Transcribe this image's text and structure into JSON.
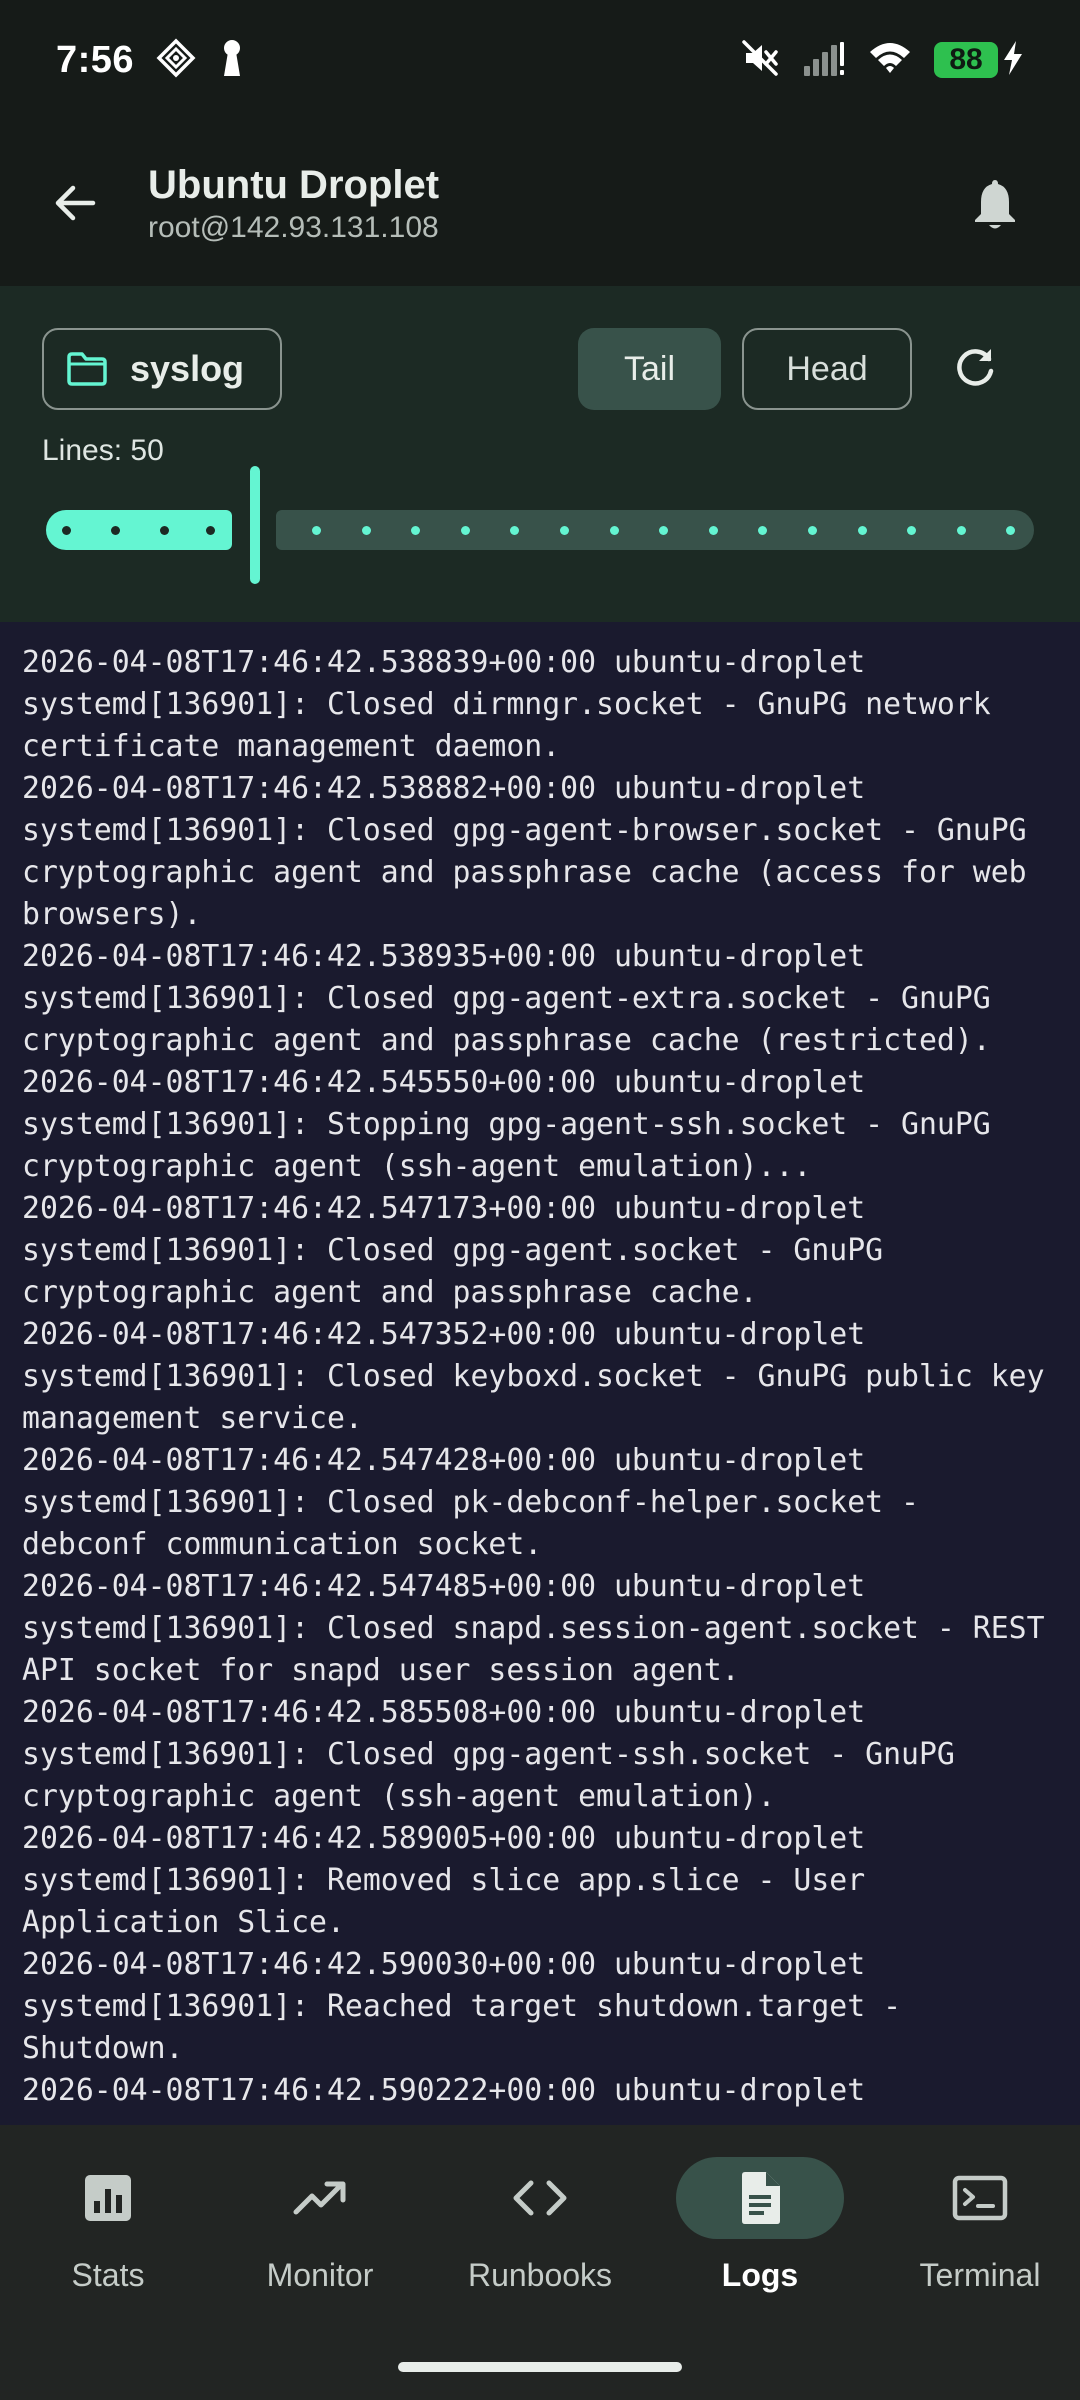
{
  "status_bar": {
    "time": "7:56",
    "battery": "88",
    "icons": [
      "location-diamond-icon",
      "keyhole-icon",
      "mute-icon",
      "signal-icon",
      "wifi-icon",
      "charging-bolt-icon"
    ]
  },
  "app_bar": {
    "title": "Ubuntu Droplet",
    "subtitle": "root@142.93.131.108"
  },
  "controls": {
    "file_label": "syslog",
    "tail_label": "Tail",
    "head_label": "Head",
    "lines_label": "Lines: 50",
    "lines_value": 50
  },
  "log": {
    "text": "2026-04-08T17:46:42.538839+00:00 ubuntu-droplet systemd[136901]: Closed dirmngr.socket - GnuPG network certificate management daemon.\n2026-04-08T17:46:42.538882+00:00 ubuntu-droplet systemd[136901]: Closed gpg-agent-browser.socket - GnuPG cryptographic agent and passphrase cache (access for web browsers).\n2026-04-08T17:46:42.538935+00:00 ubuntu-droplet systemd[136901]: Closed gpg-agent-extra.socket - GnuPG cryptographic agent and passphrase cache (restricted).\n2026-04-08T17:46:42.545550+00:00 ubuntu-droplet systemd[136901]: Stopping gpg-agent-ssh.socket - GnuPG cryptographic agent (ssh-agent emulation)...\n2026-04-08T17:46:42.547173+00:00 ubuntu-droplet systemd[136901]: Closed gpg-agent.socket - GnuPG cryptographic agent and passphrase cache.\n2026-04-08T17:46:42.547352+00:00 ubuntu-droplet systemd[136901]: Closed keyboxd.socket - GnuPG public key management service.\n2026-04-08T17:46:42.547428+00:00 ubuntu-droplet systemd[136901]: Closed pk-debconf-helper.socket - debconf communication socket.\n2026-04-08T17:46:42.547485+00:00 ubuntu-droplet systemd[136901]: Closed snapd.session-agent.socket - REST API socket for snapd user session agent.\n2026-04-08T17:46:42.585508+00:00 ubuntu-droplet systemd[136901]: Closed gpg-agent-ssh.socket - GnuPG cryptographic agent (ssh-agent emulation).\n2026-04-08T17:46:42.589005+00:00 ubuntu-droplet systemd[136901]: Removed slice app.slice - User Application Slice.\n2026-04-08T17:46:42.590030+00:00 ubuntu-droplet systemd[136901]: Reached target shutdown.target - Shutdown.\n2026-04-08T17:46:42.590222+00:00 ubuntu-droplet"
  },
  "nav": {
    "items": [
      {
        "label": "Stats",
        "icon": "bar-chart-icon"
      },
      {
        "label": "Monitor",
        "icon": "trending-up-icon"
      },
      {
        "label": "Runbooks",
        "icon": "code-icon"
      },
      {
        "label": "Logs",
        "icon": "document-icon"
      },
      {
        "label": "Terminal",
        "icon": "terminal-icon"
      }
    ],
    "active": "Logs"
  },
  "colors": {
    "accent": "#64f5d2",
    "panel": "#1c2a24",
    "log_bg": "#1a1a2e",
    "active_pill": "#38524a"
  }
}
